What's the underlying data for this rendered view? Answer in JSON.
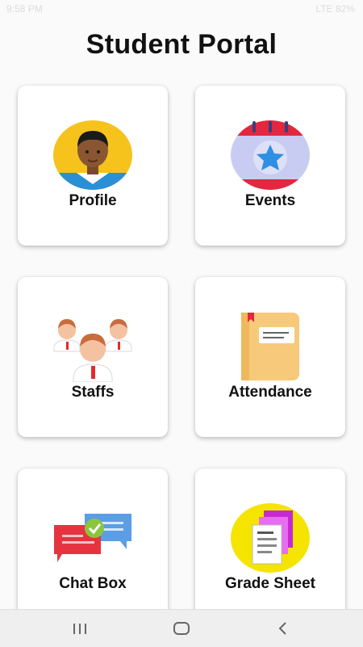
{
  "status_bar": {
    "time": "9:58 PM",
    "right_text": "LTE 82%"
  },
  "header": {
    "title": "Student Portal"
  },
  "cards": [
    {
      "label": "Profile",
      "icon": "profile-avatar-icon"
    },
    {
      "label": "Events",
      "icon": "calendar-star-icon"
    },
    {
      "label": "Staffs",
      "icon": "staff-group-icon"
    },
    {
      "label": "Attendance",
      "icon": "notebook-icon"
    },
    {
      "label": "Chat Box",
      "icon": "chat-bubbles-icon"
    },
    {
      "label": "Grade Sheet",
      "icon": "documents-icon"
    }
  ],
  "nav_bar": {
    "buttons": [
      "recent-apps",
      "home",
      "back"
    ]
  }
}
